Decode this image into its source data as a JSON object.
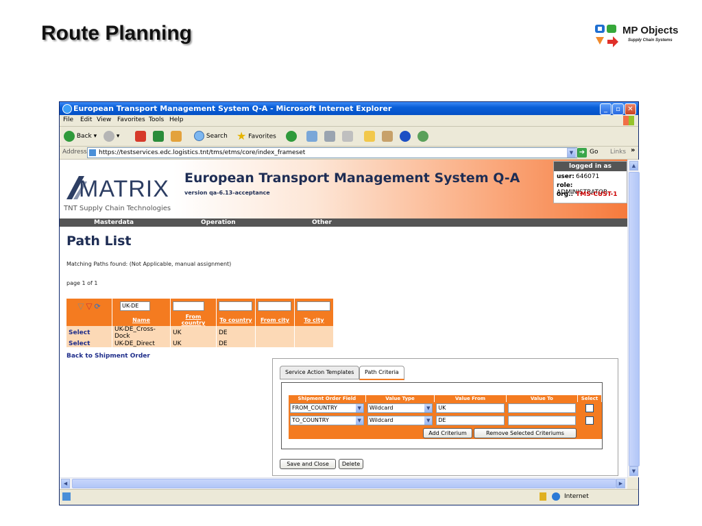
{
  "slide": {
    "title": "Route Planning",
    "logo_name": "MP Objects",
    "logo_tagline": "Supply Chain Systems"
  },
  "window": {
    "title": "European Transport Management System Q-A - Microsoft Internet Explorer",
    "menu": [
      "File",
      "Edit",
      "View",
      "Favorites",
      "Tools",
      "Help"
    ],
    "toolbar": {
      "back": "Back",
      "search": "Search",
      "favorites": "Favorites"
    },
    "address_label": "Address",
    "address_url": "https://testservices.edc.logistics.tnt/tms/etms/core/index_frameset",
    "go_label": "Go",
    "links_label": "Links",
    "status_zone": "Internet"
  },
  "app": {
    "logo": "MATRIX",
    "logo_sub": "TNT Supply Chain Technologies",
    "title": "European Transport Management System Q-A",
    "version": "version qa-6.13-acceptance",
    "login": {
      "heading": "logged in as",
      "user_label": "user:",
      "user": "646071",
      "role_label": "role:",
      "role": "ADMINISTRATOR",
      "org_label": "org.:",
      "org": "TMS-CUST-1"
    },
    "nav": [
      "Masterdata",
      "Operation",
      "Other"
    ]
  },
  "page": {
    "title": "Path List",
    "matching": "Matching Paths found: (Not Applicable, manual assignment)",
    "page_info": "page 1 of 1",
    "filter_value": "UK-DE",
    "columns": [
      "Name",
      "From country",
      "To country",
      "From city",
      "To city"
    ],
    "rows": [
      {
        "select": "Select",
        "name": "UK-DE_Cross-Dock",
        "from_country": "UK",
        "to_country": "DE",
        "from_city": "",
        "to_city": ""
      },
      {
        "select": "Select",
        "name": "UK-DE_Direct",
        "from_country": "UK",
        "to_country": "DE",
        "from_city": "",
        "to_city": ""
      }
    ],
    "back_link": "Back to Shipment Order"
  },
  "criteria": {
    "tabs": [
      "Service Action Templates",
      "Path Criteria"
    ],
    "active_tab": "Path Criteria",
    "columns": [
      "Shipment Order Field",
      "Value Type",
      "Value From",
      "Value To",
      "Select"
    ],
    "rows": [
      {
        "field": "FROM_COUNTRY",
        "value_type": "Wildcard",
        "value_from": "UK",
        "value_to": ""
      },
      {
        "field": "TO_COUNTRY",
        "value_type": "Wildcard",
        "value_from": "DE",
        "value_to": ""
      }
    ],
    "add_button": "Add Criterium",
    "remove_button": "Remove Selected Criteriums",
    "save_button": "Save and Close",
    "delete_button": "Delete"
  },
  "colors": {
    "accent": "#f47b20",
    "navy": "#1e2d54",
    "link": "#1e2d8a"
  }
}
